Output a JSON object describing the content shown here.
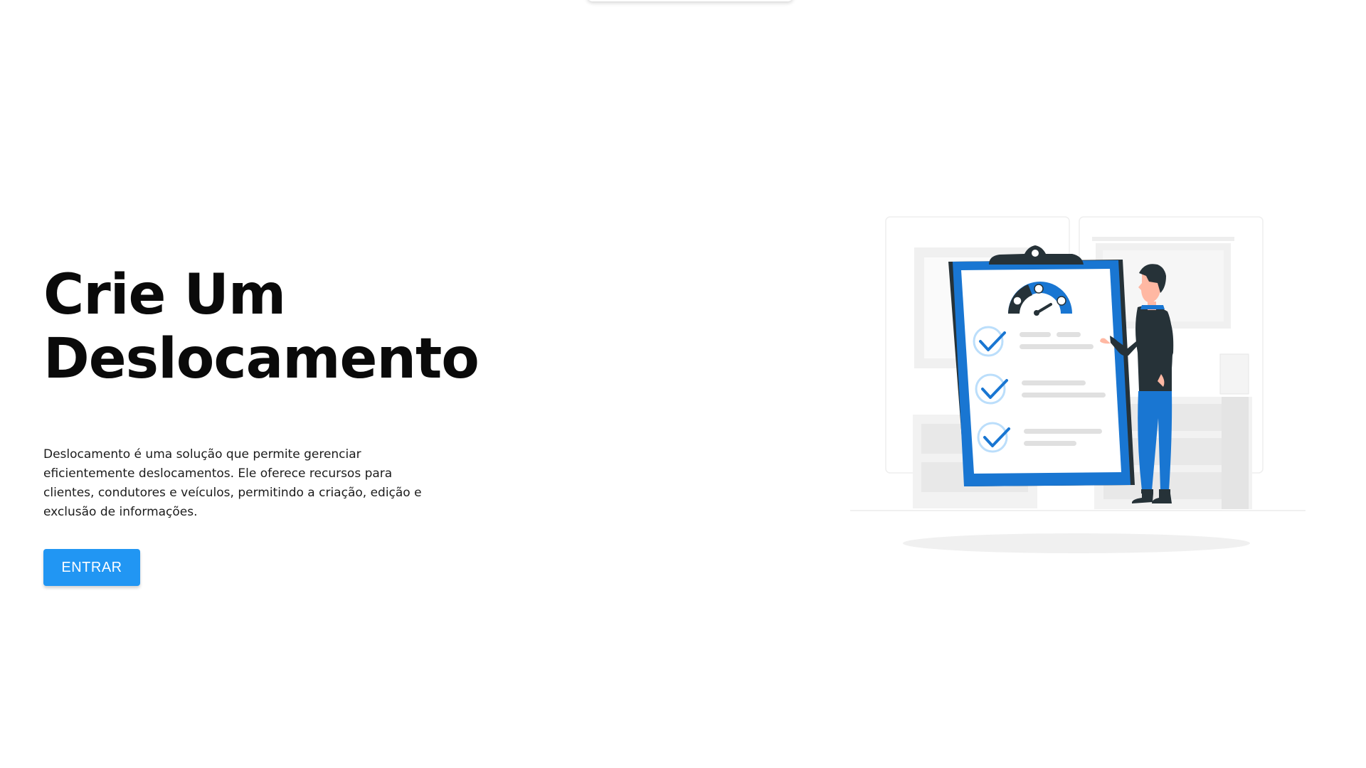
{
  "hero": {
    "title_line1": "Crie Um",
    "title_line2": "Deslocamento",
    "description": "Deslocamento é uma solução que permite gerenciar eficientemente deslocamentos. Ele oferece recursos para clientes, condutores e veículos, permitindo a criação, edição e exclusão de informações.",
    "cta_label": "ENTRAR"
  },
  "colors": {
    "accent": "#2196f3",
    "illustration_blue": "#1976d2",
    "illustration_dark": "#263238"
  }
}
